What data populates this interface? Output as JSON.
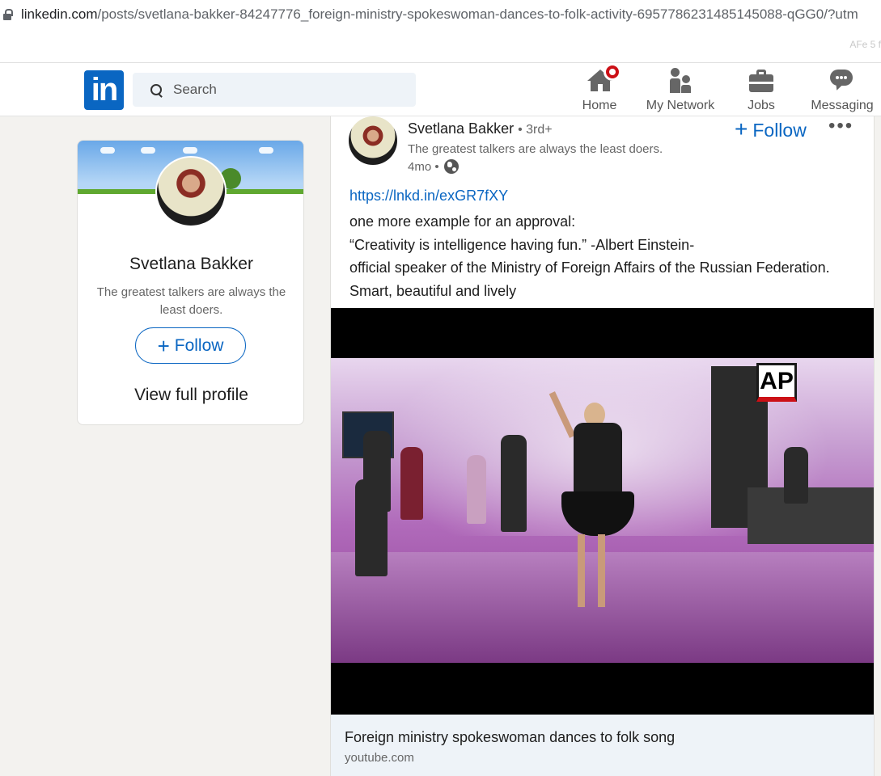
{
  "browser": {
    "url_host": "linkedin.com",
    "url_path": "/posts/svetlana-bakker-84247776_foreign-ministry-spokeswoman-dances-to-folk-activity-6957786231485145088-qGG0/?utm",
    "extension_text": "AFe 5 f"
  },
  "header": {
    "logo_text": "in",
    "search_placeholder": "Search",
    "nav": {
      "home": "Home",
      "network": "My Network",
      "jobs": "Jobs",
      "messaging": "Messaging"
    }
  },
  "profile_card": {
    "name": "Svetlana Bakker",
    "headline": "The greatest talkers are always the least doers.",
    "follow_label": "Follow",
    "view_profile_label": "View full profile"
  },
  "post": {
    "author": "Svetlana Bakker",
    "degree": "• 3rd+",
    "headline": "The greatest talkers are always the least doers.",
    "time": "4mo •",
    "follow_label": "Follow",
    "more_label": "•••",
    "link": "https://lnkd.in/exGR7fXY",
    "body_lines": [
      "one more example for an approval:",
      "“Creativity is intelligence having fun.” -Albert Einstein-",
      "official speaker of the Ministry of Foreign Affairs of the Russian Federation. Smart, beautiful and lively"
    ],
    "video_watermark": "AP",
    "preview_title": "Foreign ministry spokeswoman dances to folk song",
    "preview_source": "youtube.com"
  }
}
